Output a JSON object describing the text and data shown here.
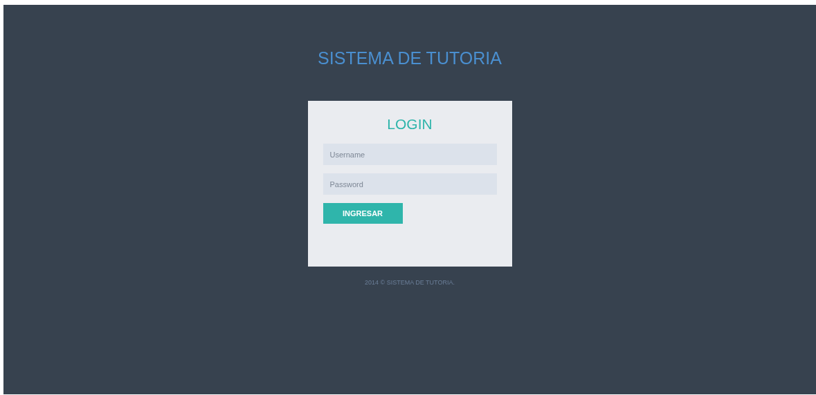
{
  "header": {
    "title": "SISTEMA DE TUTORIA"
  },
  "login_form": {
    "title": "LOGIN",
    "fields": [
      {
        "placeholder": "Username"
      },
      {
        "placeholder": "Password"
      }
    ],
    "button": "INGRESAR"
  },
  "footer": "2014 © SISTEMA DE TUTORIA."
}
